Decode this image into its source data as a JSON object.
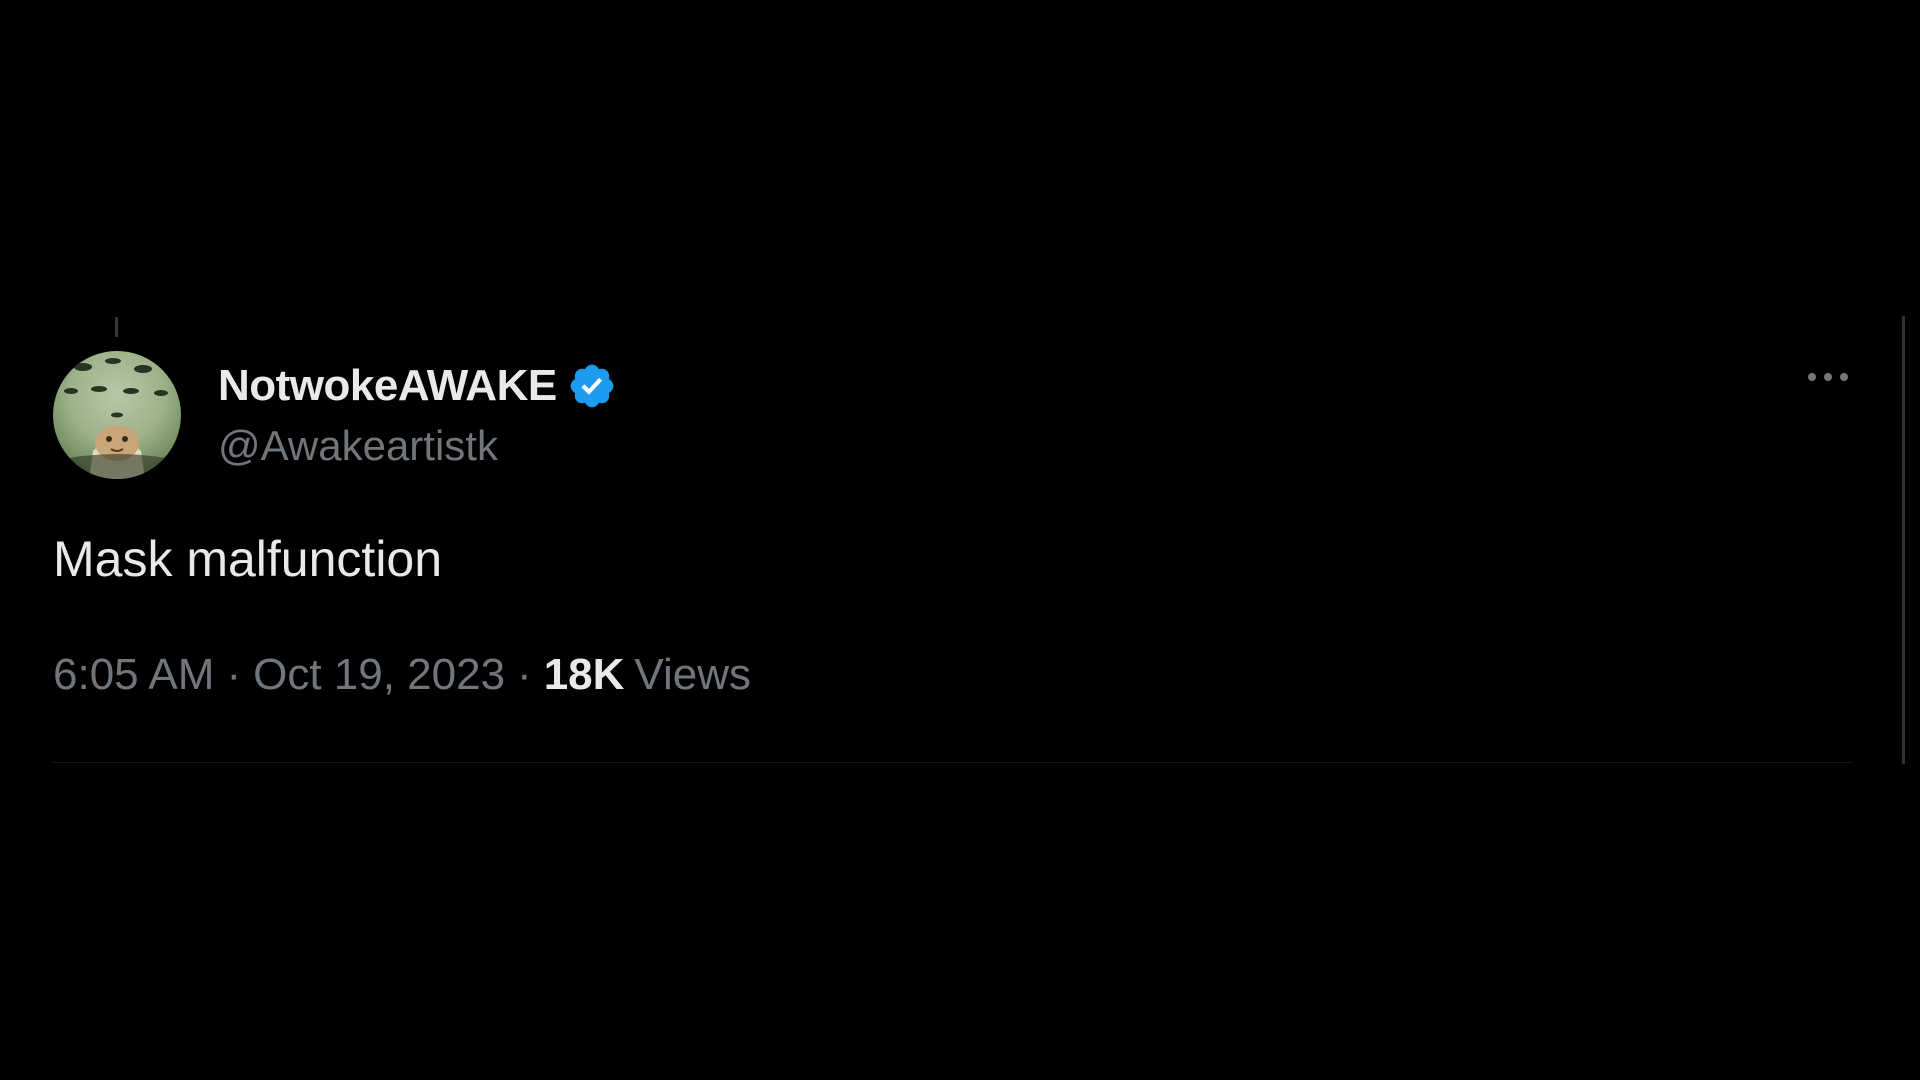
{
  "tweet": {
    "display_name": "NotwokeAWAKE",
    "handle": "@Awakeartistk",
    "verified": true,
    "text": "Mask malfunction",
    "time": "6:05 AM",
    "date": "Oct 19, 2023",
    "separator": "·",
    "views_count": "18K",
    "views_label": "Views",
    "more_icon": "more-horizontal-icon",
    "verified_icon": "verified-badge-icon"
  },
  "colors": {
    "background": "#000000",
    "primary_text": "#e7e9ea",
    "secondary_text": "#71767b",
    "verified_blue": "#1d9bf0"
  }
}
